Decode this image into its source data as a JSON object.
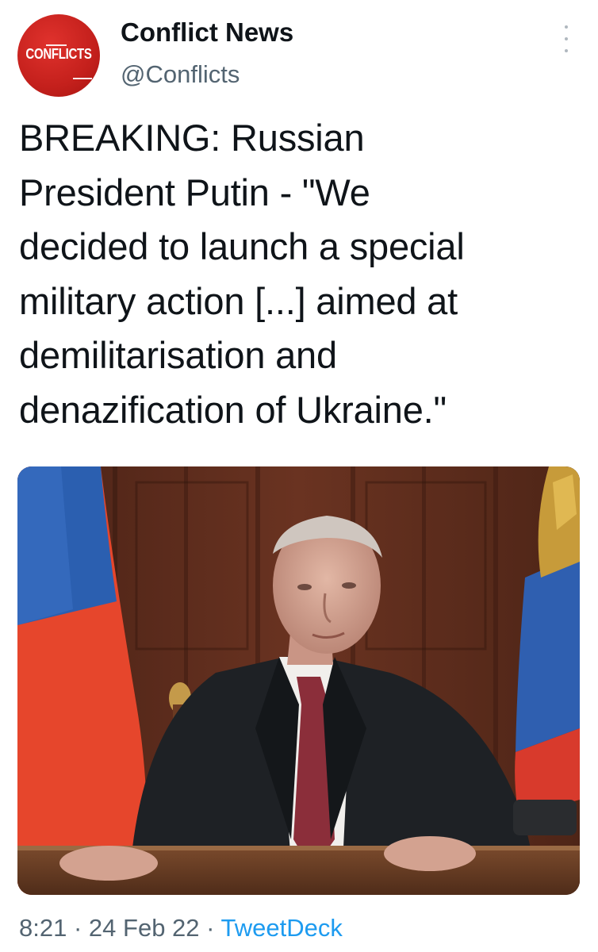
{
  "account": {
    "display_name": "Conflict News",
    "handle": "@Conflicts",
    "avatar_text": "CONFLICTS",
    "avatar_color": "#c4201c"
  },
  "tweet": {
    "text_lines": [
      "BREAKING: Russian",
      "President Putin - \"We",
      "decided to launch a special",
      "military action [...] aimed at",
      "demilitarisation and",
      "denazification of Ukraine.\""
    ],
    "time": "8:21",
    "date": "24 Feb 22",
    "separator": "·",
    "source": "TweetDeck"
  },
  "icons": {
    "more": "more-vertical-icon"
  },
  "colors": {
    "link": "#1d9bf0",
    "secondary": "#536471",
    "primary_text": "#0f1419"
  }
}
